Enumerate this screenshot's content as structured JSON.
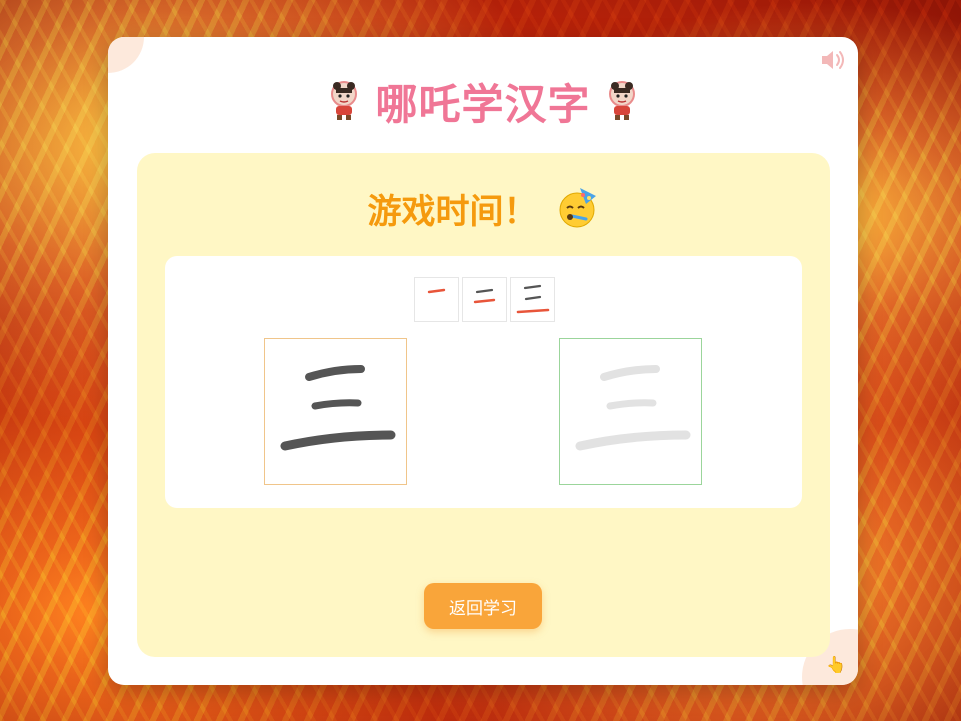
{
  "app": {
    "title": "哪吒学汉字",
    "avatar_icon": "nezha-avatar-icon",
    "sound_icon": "speaker-icon",
    "cursor_icon": "pointing-hand-icon"
  },
  "game": {
    "title": "游戏时间！",
    "title_icon": "party-face-icon",
    "character": "三",
    "stroke_steps": [
      "一",
      "二",
      "三"
    ],
    "back_button_label": "返回学习"
  },
  "colors": {
    "title_pink": "#f07696",
    "game_title_orange": "#f59a0e",
    "panel_yellow": "#fff7c5",
    "button_orange": "#f9a53a",
    "stroke_highlight": "#e8553a"
  }
}
